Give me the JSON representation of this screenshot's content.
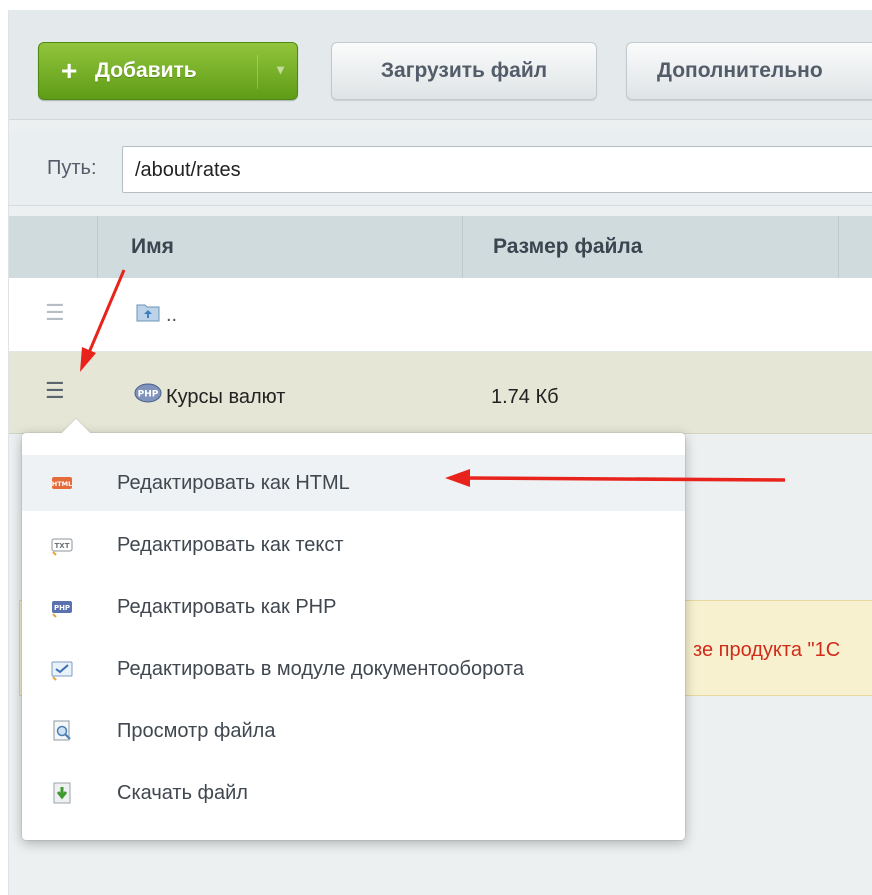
{
  "toolbar": {
    "add_label": "Добавить",
    "upload_label": "Загрузить файл",
    "more_label": "Дополнительно"
  },
  "path": {
    "label": "Путь:",
    "value": "/about/rates"
  },
  "table": {
    "columns": [
      "Имя",
      "Размер файла"
    ],
    "up_row": {
      "name": ".."
    },
    "rows": [
      {
        "name": "Курсы валют",
        "size": "1.74 Кб"
      }
    ]
  },
  "notice": {
    "text": "зе продукта \"1С"
  },
  "context_menu": {
    "items": [
      {
        "label": "Редактировать как HTML",
        "icon": "html-file-icon"
      },
      {
        "label": "Редактировать как текст",
        "icon": "txt-file-icon"
      },
      {
        "label": "Редактировать как PHP",
        "icon": "php-file-icon"
      },
      {
        "label": "Редактировать в модуле документооборота",
        "icon": "workflow-edit-icon"
      },
      {
        "label": "Просмотр файла",
        "icon": "view-file-icon"
      },
      {
        "label": "Скачать файл",
        "icon": "download-file-icon"
      }
    ]
  },
  "colors": {
    "add_button": "#6aa81f",
    "selected_row": "#e5e6d6",
    "arrow": "#e8231b"
  }
}
